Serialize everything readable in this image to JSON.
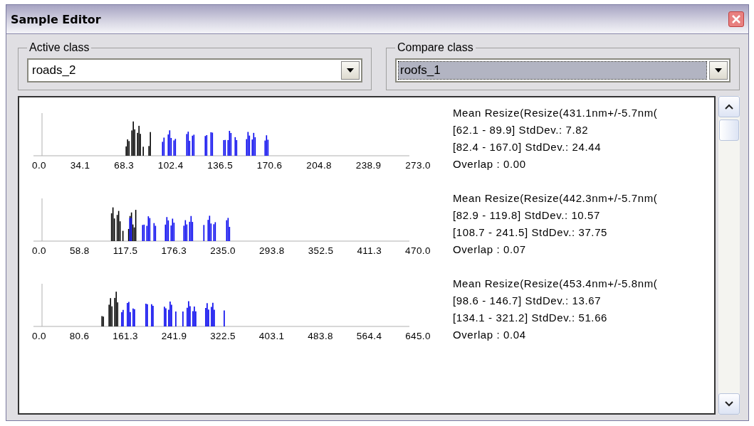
{
  "window": {
    "title": "Sample Editor"
  },
  "active_class": {
    "label": "Active class",
    "value": "roads_2",
    "focused": false
  },
  "compare_class": {
    "label": "Compare class",
    "value": "roofs_1",
    "focused": true
  },
  "features": [
    {
      "axis_labels": [
        "0.0",
        "34.1",
        "68.3",
        "102.4",
        "136.5",
        "170.6",
        "204.8",
        "238.9",
        "273.0"
      ],
      "lines": [
        "Mean Resize(Resize(431.1nm+/-5.7nm(",
        "[62.1 - 89.9] StdDev.: 7.82",
        "[82.4 - 167.0] StdDev.: 24.44",
        "Overlap : 0.00"
      ]
    },
    {
      "axis_labels": [
        "0.0",
        "58.8",
        "117.5",
        "176.3",
        "235.0",
        "293.8",
        "352.5",
        "411.3",
        "470.0"
      ],
      "lines": [
        "Mean Resize(Resize(442.3nm+/-5.7nm(",
        "[82.9 - 119.8] StdDev.: 10.57",
        "[108.7 - 241.5] StdDev.: 37.75",
        "Overlap : 0.07"
      ]
    },
    {
      "axis_labels": [
        "0.0",
        "80.6",
        "161.3",
        "241.9",
        "322.5",
        "403.1",
        "483.8",
        "564.4",
        "645.0"
      ],
      "lines": [
        "Mean Resize(Resize(453.4nm+/-5.8nm(",
        "[98.6 - 146.7] StdDev.: 13.67",
        "[134.1 - 321.2] StdDev.: 51.66",
        "Overlap : 0.04"
      ]
    }
  ]
}
